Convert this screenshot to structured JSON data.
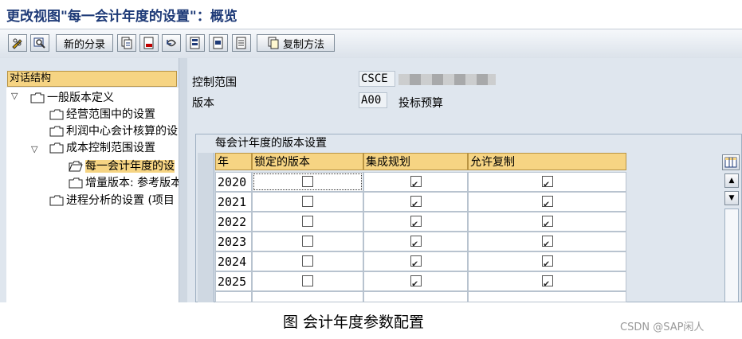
{
  "window": {
    "title": "更改视图\"每一会计年度的设置\"：概览"
  },
  "toolbar": {
    "new_entries_label": "新的分录",
    "copy_method_label": "复制方法"
  },
  "tree": {
    "header": "对话结构",
    "nodes": [
      {
        "label": "一般版本定义",
        "expanded": true
      },
      {
        "label": "经营范围中的设置"
      },
      {
        "label": "利润中心会计核算的设"
      },
      {
        "label": "成本控制范围设置",
        "expanded": true
      },
      {
        "label": "每一会计年度的设",
        "selected": true
      },
      {
        "label": "增量版本: 参考版本"
      },
      {
        "label": "进程分析的设置 (项目"
      }
    ]
  },
  "fields": {
    "controlling_area": {
      "label": "控制范围",
      "value": "CSCE"
    },
    "version": {
      "label": "版本",
      "value": "A00",
      "description": "投标预算"
    }
  },
  "table": {
    "title": "每会计年度的版本设置",
    "columns": [
      "年",
      "锁定的版本",
      "集成规划",
      "允许复制"
    ],
    "rows": [
      {
        "year": "2020",
        "locked": false,
        "integrated": true,
        "copy": true
      },
      {
        "year": "2021",
        "locked": false,
        "integrated": true,
        "copy": true
      },
      {
        "year": "2022",
        "locked": false,
        "integrated": true,
        "copy": true
      },
      {
        "year": "2023",
        "locked": false,
        "integrated": true,
        "copy": true
      },
      {
        "year": "2024",
        "locked": false,
        "integrated": true,
        "copy": true
      },
      {
        "year": "2025",
        "locked": false,
        "integrated": true,
        "copy": true
      }
    ]
  },
  "caption": {
    "text": "图  会计年度参数配置",
    "watermark": "CSDN @SAP闲人"
  },
  "colors": {
    "header_gold": "#f6d483",
    "panel_blue": "#dfe6ee",
    "title_blue": "#1f3b78"
  }
}
